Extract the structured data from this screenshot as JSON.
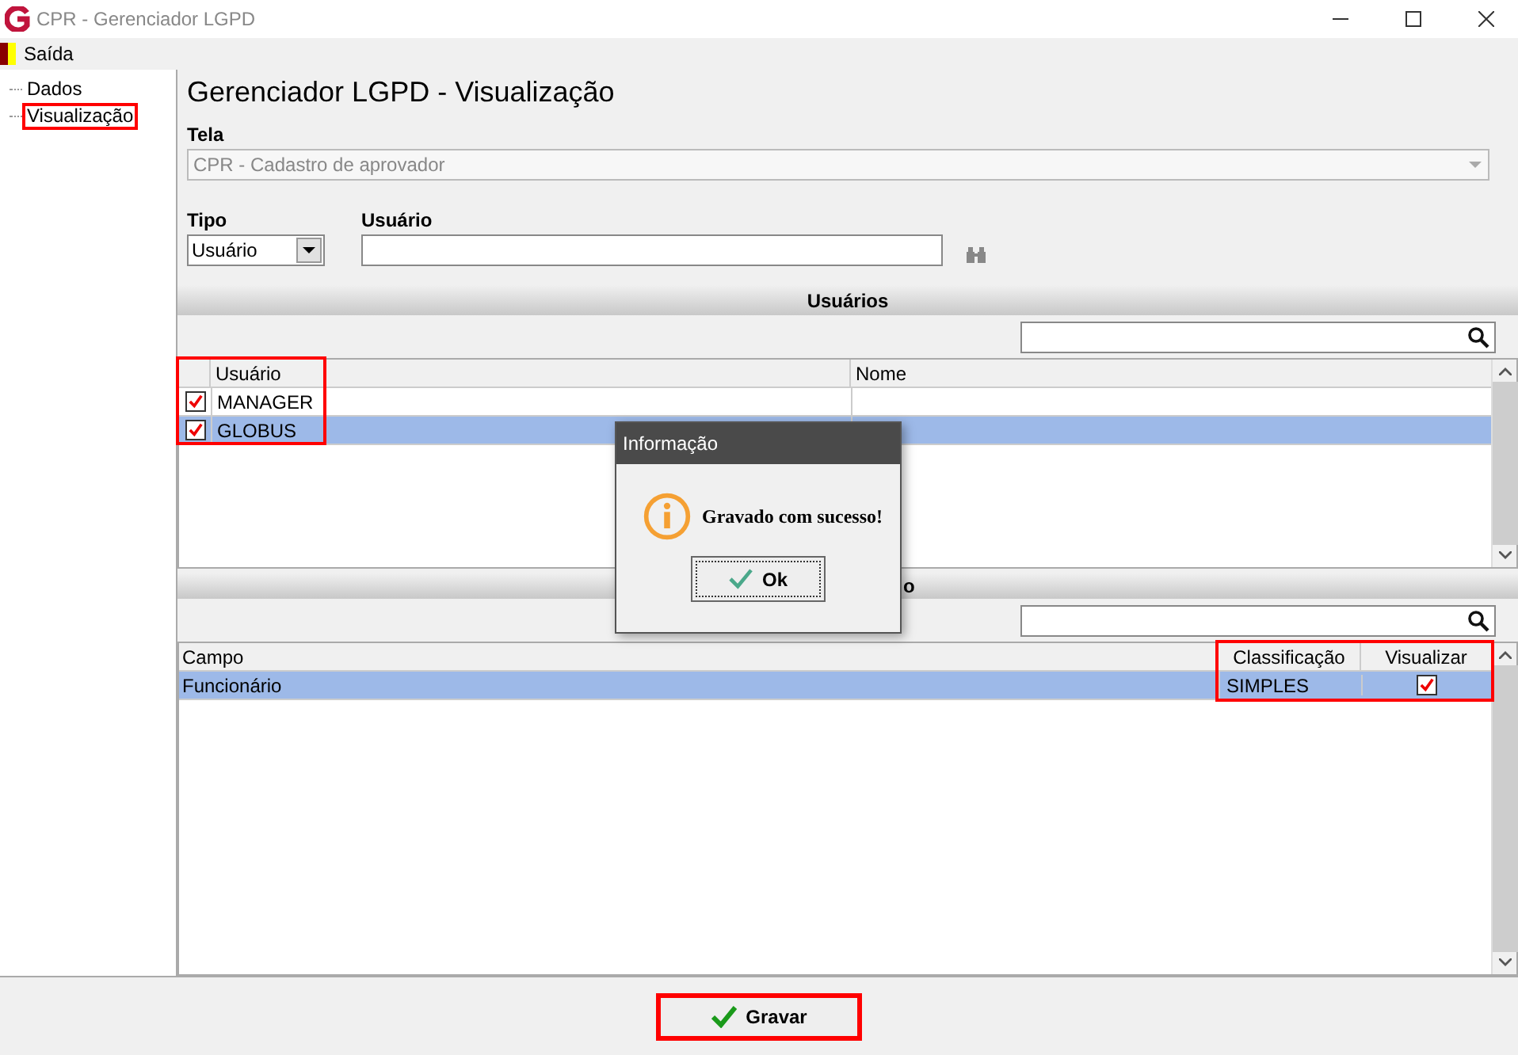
{
  "window": {
    "title": "CPR - Gerenciador LGPD"
  },
  "menu": [
    {
      "label": "Saída"
    }
  ],
  "sidebar": {
    "items": [
      {
        "label": "Dados",
        "highlighted": false
      },
      {
        "label": "Visualização",
        "highlighted": true
      }
    ]
  },
  "page_title": "Gerenciador LGPD - Visualização",
  "tela": {
    "label": "Tela",
    "value": "CPR - Cadastro de aprovador"
  },
  "tipo": {
    "label": "Tipo",
    "value": "Usuário"
  },
  "usuario": {
    "label": "Usuário"
  },
  "users_panel": {
    "header": "Usuários",
    "highlighted": true,
    "columns": [
      "Usuário",
      "Nome"
    ],
    "rows": [
      {
        "usuario": "MANAGER",
        "checked": true,
        "selected": false
      },
      {
        "usuario": "GLOBUS",
        "checked": true,
        "selected": true
      }
    ]
  },
  "fields_panel": {
    "header": "o",
    "highlighted": true,
    "columns": [
      "Campo",
      "Classificação",
      "Visualizar"
    ],
    "rows": [
      {
        "campo": "Funcionário",
        "classificacao": "SIMPLES",
        "checked": true,
        "selected": true
      }
    ]
  },
  "dialog": {
    "title": "Informação",
    "message": "Gravado com sucesso!",
    "button": "Ok"
  },
  "save_button": {
    "label": "Gravar",
    "highlighted": true
  }
}
